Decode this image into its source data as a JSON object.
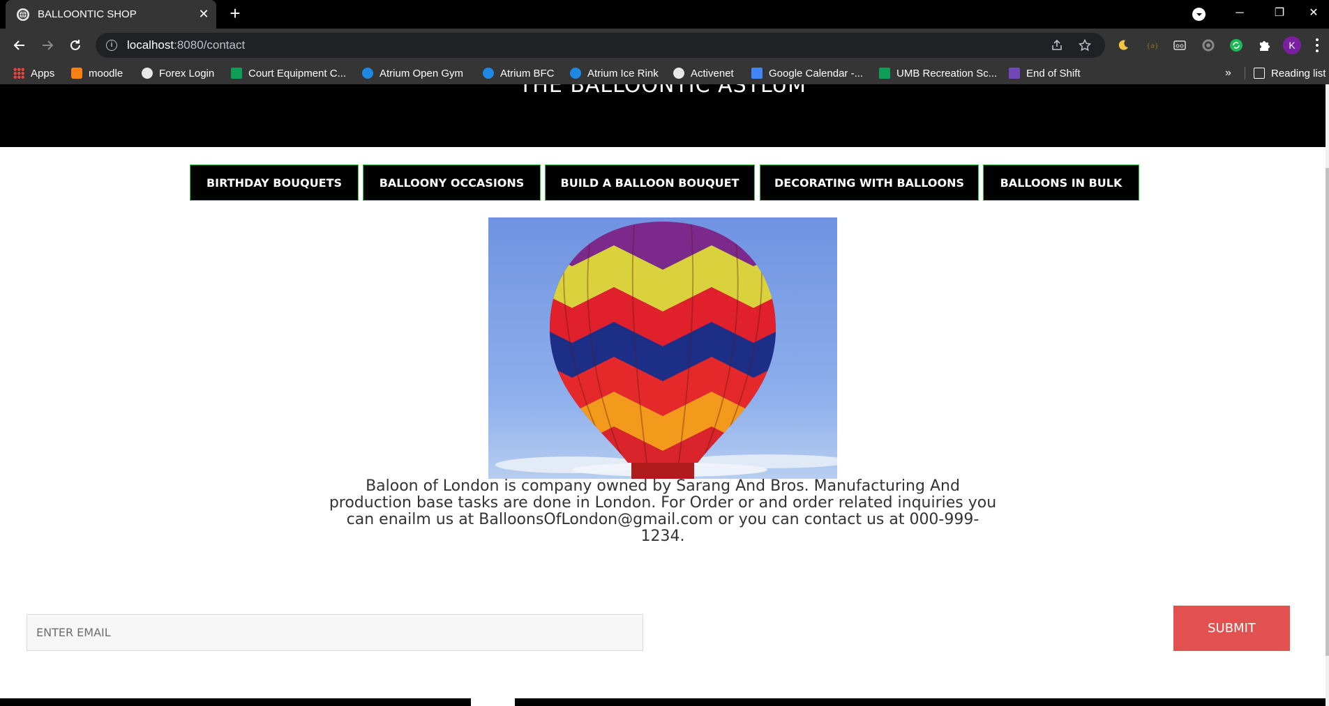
{
  "browser": {
    "tab_title": "BALLOONTIC SHOP",
    "tab_close": "✕",
    "new_tab": "+",
    "window_minimize": "─",
    "window_restore": "❐",
    "window_close": "✕",
    "url_host": "localhost",
    "url_path": ":8080/contact",
    "profile_initial": "K",
    "bookmarks": [
      {
        "label": "Apps",
        "icon": "apps-grid-icon",
        "color": "#e8453c"
      },
      {
        "label": "moodle",
        "icon": "moodle-icon",
        "color": "#f98012"
      },
      {
        "label": "Forex Login",
        "icon": "globe-icon",
        "color": "#e8e8e8"
      },
      {
        "label": "Court Equipment C...",
        "icon": "sheets-icon",
        "color": "#0f9d58"
      },
      {
        "label": "Atrium Open Gym",
        "icon": "atrium-icon",
        "color": "#1e88e5"
      },
      {
        "label": "Atrium BFC",
        "icon": "atrium-icon",
        "color": "#1e88e5"
      },
      {
        "label": "Atrium Ice Rink",
        "icon": "atrium-icon",
        "color": "#1e88e5"
      },
      {
        "label": "Activenet",
        "icon": "globe-icon",
        "color": "#e8e8e8"
      },
      {
        "label": "Google Calendar -...",
        "icon": "calendar-icon",
        "color": "#4285f4"
      },
      {
        "label": "UMB Recreation Sc...",
        "icon": "sheets-icon",
        "color": "#0f9d58"
      },
      {
        "label": "End of Shift",
        "icon": "forms-icon",
        "color": "#7248b9"
      }
    ],
    "bookmarks_overflow": "»",
    "reading_list": "Reading list"
  },
  "site": {
    "title": "THE BALLOONTIC ASYLUM",
    "nav": [
      "BIRTHDAY BOUQUETS",
      "BALLOONY OCCASIONS",
      "BUILD A BALLOON BOUQUET",
      "DECORATING WITH BALLOONS",
      "BALLOONS IN BULK"
    ],
    "about_text": "Baloon of London is company owned by Sarang And Bros. Manufacturing And production base tasks are done in London. For Order or and order related inquiries you can enailm us at BalloonsOfLondon@gmail.com or you can contact us at 000-999-1234.",
    "email_placeholder": "ENTER EMAIL",
    "email_value": "",
    "submit_label": "SUBMIT"
  },
  "colors": {
    "nav_border": "#2ecc40",
    "submit_bg": "#e2514f",
    "hero_bg": "#000000"
  }
}
